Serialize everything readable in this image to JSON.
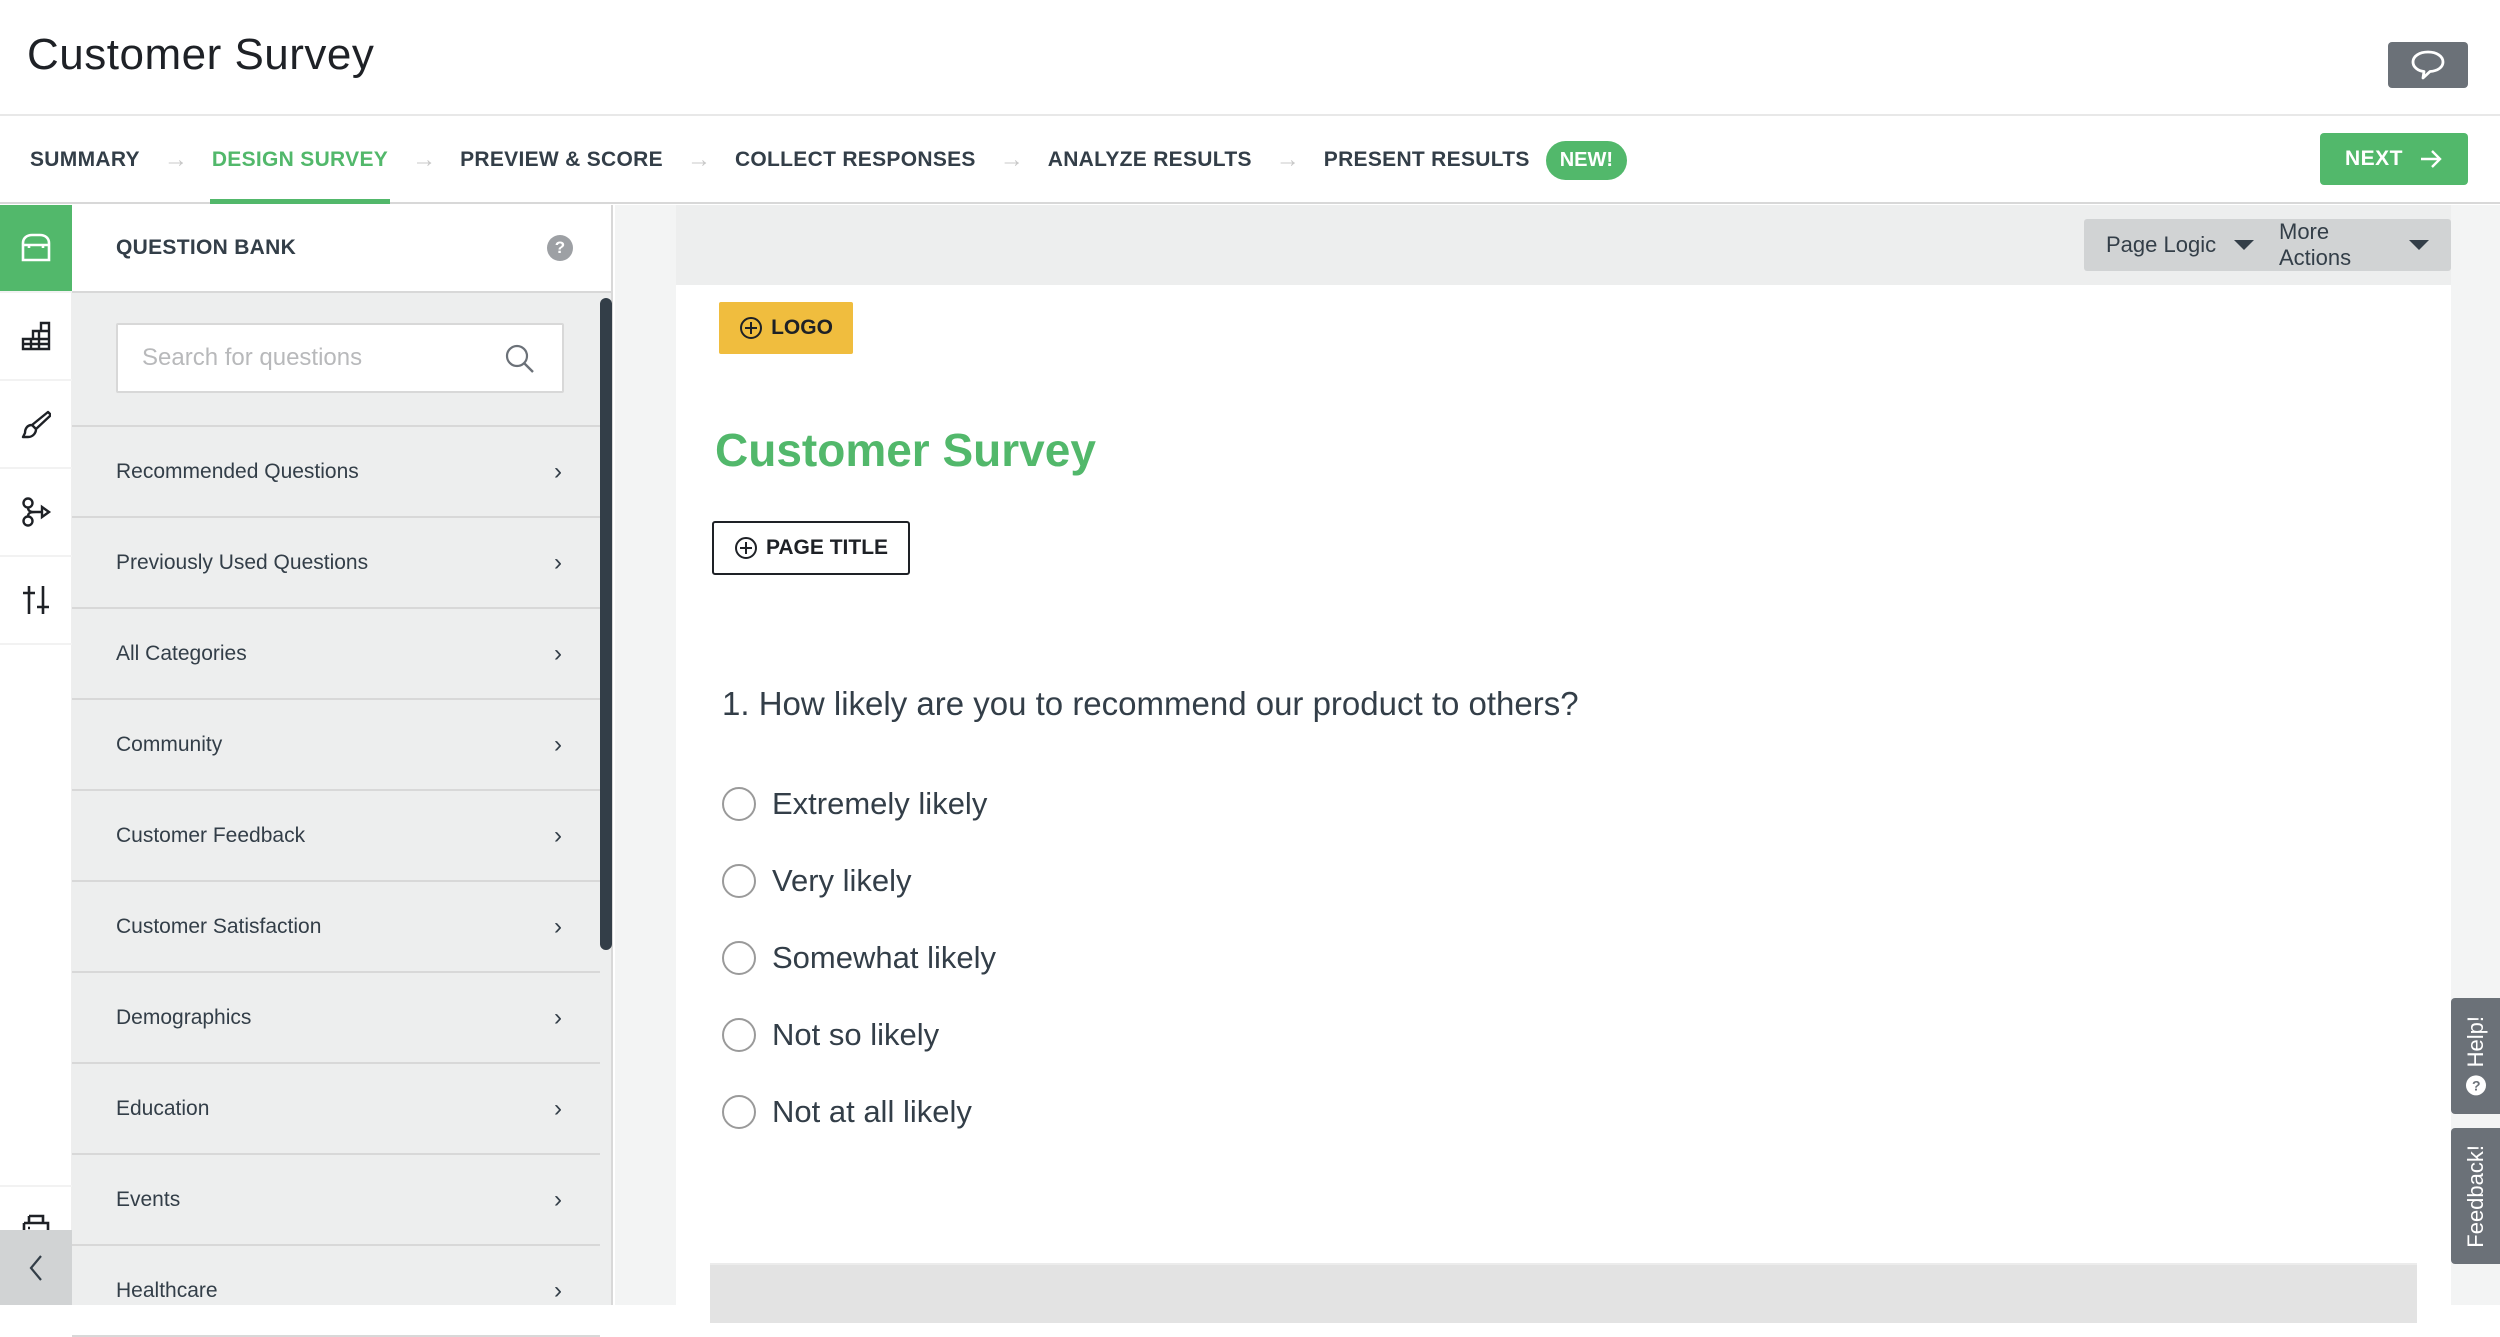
{
  "header": {
    "title": "Customer Survey",
    "chat_icon": "speech-bubble-icon"
  },
  "nav": {
    "steps": [
      {
        "label": "SUMMARY",
        "active": false
      },
      {
        "label": "DESIGN SURVEY",
        "active": true
      },
      {
        "label": "PREVIEW & SCORE",
        "active": false
      },
      {
        "label": "COLLECT RESPONSES",
        "active": false
      },
      {
        "label": "ANALYZE RESULTS",
        "active": false
      },
      {
        "label": "PRESENT RESULTS",
        "active": false
      }
    ],
    "new_badge": "NEW!",
    "next_label": "NEXT",
    "separator": "→"
  },
  "iconbar": {
    "items": [
      "question-bank-icon",
      "builder-icon",
      "style-paintbrush-icon",
      "logic-icon",
      "options-sliders-icon"
    ],
    "print_icon": "print-icon",
    "collapse_icon": "chevron-left-icon"
  },
  "panel": {
    "title": "QUESTION BANK",
    "help": "?",
    "search_placeholder": "Search for questions",
    "search_value": "",
    "categories": [
      "Recommended Questions",
      "Previously Used Questions",
      "All Categories",
      "Community",
      "Customer Feedback",
      "Customer Satisfaction",
      "Demographics",
      "Education",
      "Events",
      "Healthcare"
    ],
    "chevron": "›"
  },
  "toolbar": {
    "page_logic": "Page Logic",
    "more_actions": "More Actions"
  },
  "canvas": {
    "logo_label": "LOGO",
    "survey_title": "Customer Survey",
    "page_title_label": "PAGE TITLE",
    "question": "1. How likely are you to recommend our product to others?",
    "options": [
      "Extremely likely",
      "Very likely",
      "Somewhat likely",
      "Not so likely",
      "Not at all likely"
    ]
  },
  "side_tabs": {
    "help": "Help!",
    "help_q": "?",
    "feedback": "Feedback!"
  },
  "colors": {
    "brand_green": "#52b86b",
    "logo_yellow": "#f0bd3e",
    "dark_text": "#333e48",
    "side_tab_gray": "#6b7178"
  }
}
